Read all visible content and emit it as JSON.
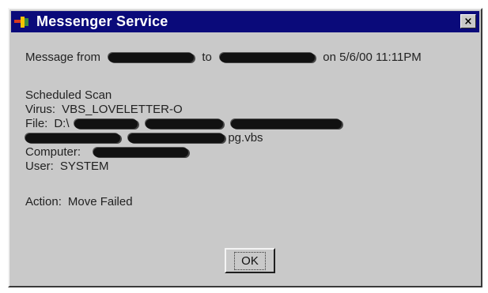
{
  "window": {
    "title": "Messenger Service",
    "close_glyph": "×",
    "colors": {
      "titlebar": "#0a0a7a",
      "face": "#c9c9c9"
    }
  },
  "message": {
    "from_prefix": "Message from",
    "to_label": "to",
    "on_label": "on",
    "datetime": "5/6/00 11:11PM",
    "scan_title": "Scheduled Scan",
    "virus_label": "Virus:",
    "virus_value": "VBS_LOVELETTER-O",
    "file_label": "File:",
    "file_path_start": "D:\\",
    "file_path_end": "pg.vbs",
    "computer_label": "Computer:",
    "user_label": "User:",
    "user_value": "SYSTEM",
    "action_label": "Action:",
    "action_value": "Move Failed"
  },
  "buttons": {
    "ok_label": "OK"
  }
}
